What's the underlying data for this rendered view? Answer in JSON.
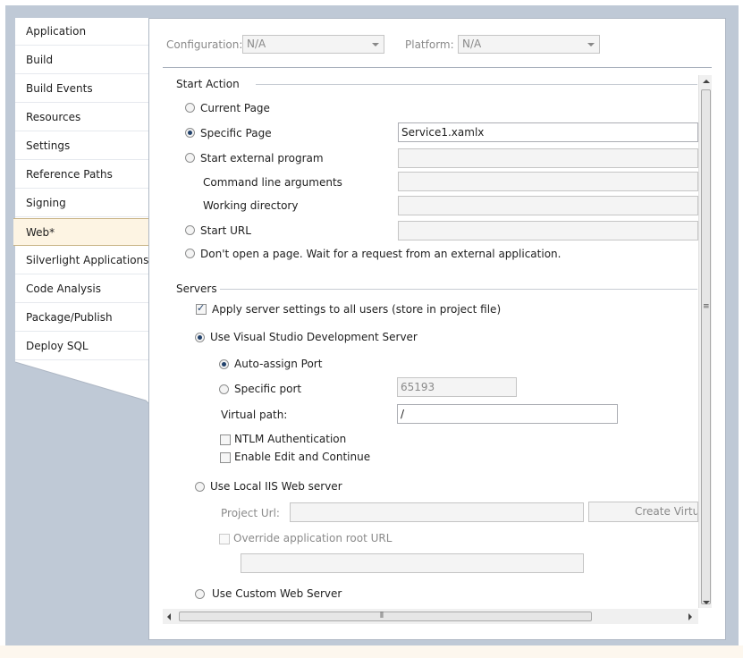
{
  "sidebar": {
    "items": [
      {
        "label": "Application"
      },
      {
        "label": "Build"
      },
      {
        "label": "Build Events"
      },
      {
        "label": "Resources"
      },
      {
        "label": "Settings"
      },
      {
        "label": "Reference Paths"
      },
      {
        "label": "Signing"
      },
      {
        "label": "Web*"
      },
      {
        "label": "Silverlight Applications"
      },
      {
        "label": "Code Analysis"
      },
      {
        "label": "Package/Publish"
      },
      {
        "label": "Deploy SQL"
      }
    ],
    "active": "Web*"
  },
  "header": {
    "configuration_label": "Configuration:",
    "configuration_value": "N/A",
    "platform_label": "Platform:",
    "platform_value": "N/A"
  },
  "start_action": {
    "title": "Start Action",
    "current_page": "Current Page",
    "specific_page": "Specific Page",
    "specific_page_value": "Service1.xamlx",
    "start_external_program": "Start external program",
    "command_line_arguments": "Command line arguments",
    "working_directory": "Working directory",
    "start_url": "Start URL",
    "dont_open": "Don't open a page.  Wait for a request from an external application.",
    "selected": "Specific Page"
  },
  "servers": {
    "title": "Servers",
    "apply_all_users": "Apply server settings to all users (store in project file)",
    "use_vs_dev_server": "Use Visual Studio Development Server",
    "auto_assign_port": "Auto-assign Port",
    "specific_port": "Specific port",
    "specific_port_value": "65193",
    "virtual_path_label": "Virtual path:",
    "virtual_path_value": "/",
    "ntlm_auth": "NTLM Authentication",
    "enable_edit_continue": "Enable Edit and Continue",
    "use_local_iis": "Use Local IIS Web server",
    "project_url_label": "Project Url:",
    "create_virtual_button": "Create Virtual Directory",
    "override_root_url": "Override application root URL",
    "use_custom_web_server": "Use Custom Web Server"
  },
  "colors": {
    "frame": "#bfc9d6",
    "active_tab": "#fdf4e3",
    "radio_dot": "#21416b"
  }
}
